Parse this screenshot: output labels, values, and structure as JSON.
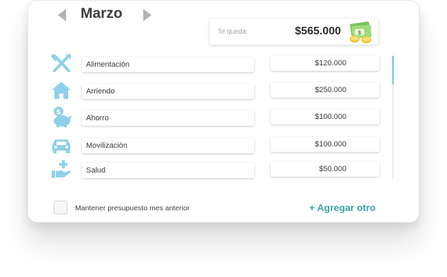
{
  "month": {
    "title": "Marzo"
  },
  "remaining": {
    "label": "Te queda:",
    "amount": "$565.000"
  },
  "categories": [
    {
      "name": "Alimentación",
      "amount": "$120.000",
      "icon": "fork-knife-icon"
    },
    {
      "name": "Arriendo",
      "amount": "$250.000",
      "icon": "house-icon"
    },
    {
      "name": "Ahorro",
      "amount": "$100.000",
      "icon": "piggy-bank-icon"
    },
    {
      "name": "Movilización",
      "amount": "$100.000",
      "icon": "car-icon"
    },
    {
      "name": "Salud",
      "amount": "$50.000",
      "icon": "health-hand-icon"
    }
  ],
  "footer": {
    "keep_label": "Mantener presupuesto mes anterior",
    "add_label": "+ Agregar otro"
  },
  "colors": {
    "icon": "#8fd0ea",
    "accent": "#37a3a6",
    "arrow": "#b3b3b3"
  }
}
